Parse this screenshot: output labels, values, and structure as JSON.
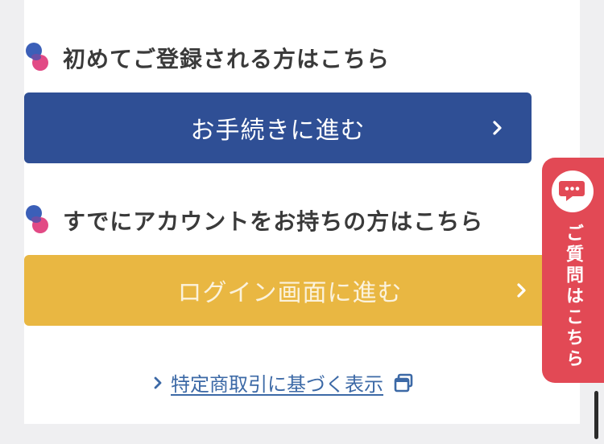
{
  "register": {
    "heading": "初めてご登録される方はこちら",
    "button_label": "お手続きに進む"
  },
  "login": {
    "heading": "すでにアカウントをお持ちの方はこちら",
    "button_label": "ログイン画面に進む"
  },
  "legal_link": "特定商取引に基づく表示",
  "faq_tab": {
    "label": "ご質問はこちら",
    "icon": "chat-bubble-icon"
  },
  "colors": {
    "primary": "#2f4f95",
    "secondary": "#e9b742",
    "accent": "#e24955",
    "link": "#3c69a6"
  }
}
